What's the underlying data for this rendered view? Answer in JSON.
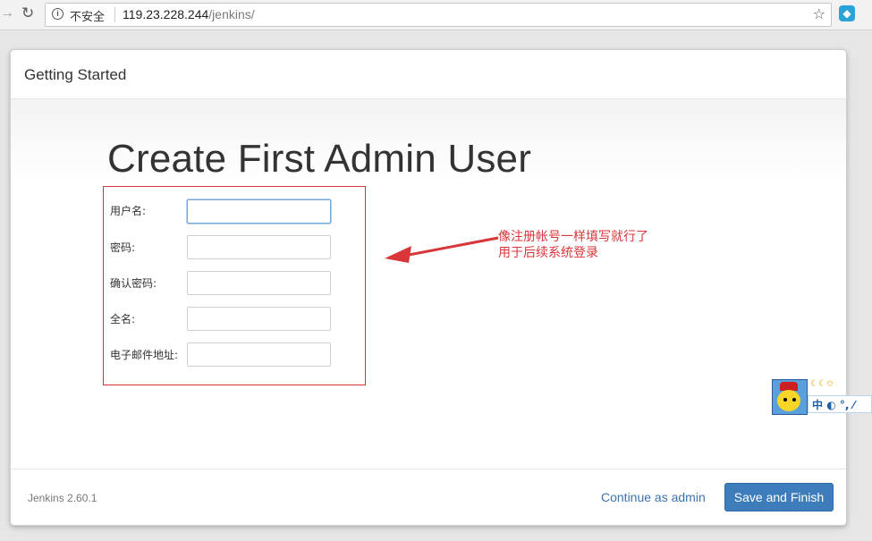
{
  "browser": {
    "security_label": "不安全",
    "url_host": "119.23.228.244",
    "url_path": "/jenkins/"
  },
  "dialog": {
    "header_title": "Getting Started",
    "page_title": "Create First Admin User",
    "fields": [
      {
        "label": "用户名:",
        "value": ""
      },
      {
        "label": "密码:",
        "value": ""
      },
      {
        "label": "确认密码:",
        "value": ""
      },
      {
        "label": "全名:",
        "value": ""
      },
      {
        "label": "电子邮件地址:",
        "value": ""
      }
    ],
    "annotation_line1": "像注册帐号一样填写就行了",
    "annotation_line2": "用于后续系统登录",
    "footer": {
      "version": "Jenkins 2.60.1",
      "continue_label": "Continue as admin",
      "save_label": "Save and Finish"
    }
  },
  "ime": {
    "mode_label": "中",
    "extra_label": "◐ °, ⁄"
  },
  "colors": {
    "annotation": "#d8363a",
    "primary_button": "#3d7dbb",
    "link": "#3b73af"
  }
}
